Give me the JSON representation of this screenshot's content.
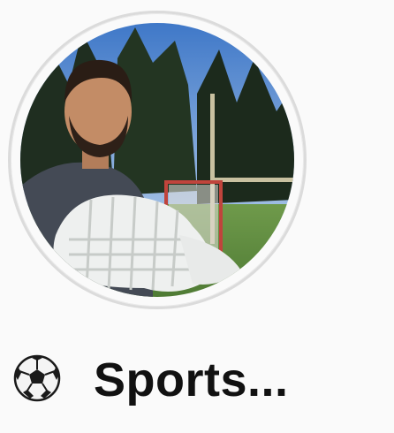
{
  "highlight": {
    "title": "Sports...",
    "emoji_icon": "soccer-ball-icon",
    "ring_color": "#dbdbdb"
  }
}
